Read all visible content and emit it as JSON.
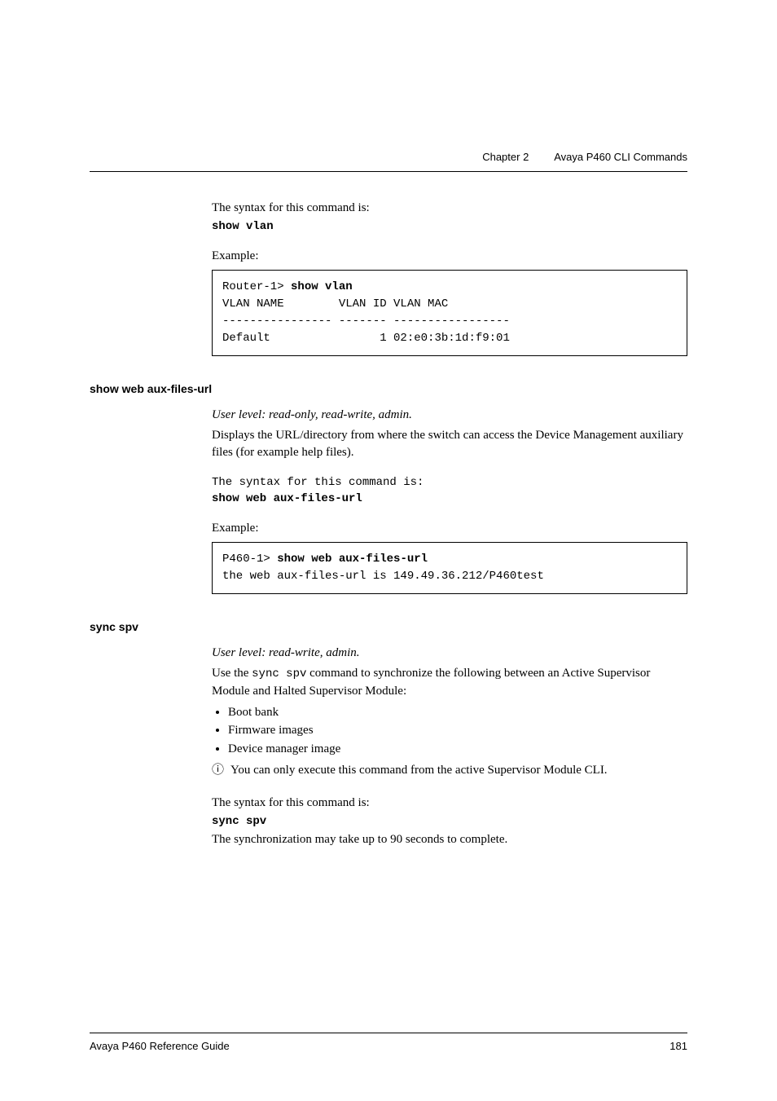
{
  "header": {
    "chapter": "Chapter 2",
    "title": "Avaya P460 CLI Commands"
  },
  "intro": {
    "syntax_label": "The syntax for this command is:",
    "syntax_cmd": "show vlan",
    "example_label": "Example:"
  },
  "example1": {
    "prompt": "Router-1> ",
    "cmd": "show vlan",
    "line2": "VLAN NAME        VLAN ID VLAN MAC",
    "line3": "---------------- ------- -----------------",
    "line4": "Default                1 02:e0:3b:1d:f9:01"
  },
  "section2": {
    "heading": "show web aux-files-url",
    "userlevel": "User level: read-only, read-write, admin.",
    "desc1": "Displays the URL/directory from where the switch can access the Device Management auxiliary files (for example help files).",
    "syntax_label": "The syntax for this command is:",
    "syntax_cmd": "show web aux-files-url",
    "example_label": "Example:"
  },
  "example2": {
    "prompt": "P460-1> ",
    "cmd": "show web aux-files-url",
    "line2": "the web aux-files-url is 149.49.36.212/P460test"
  },
  "section3": {
    "heading": "sync spv",
    "userlevel": "User level: read-write, admin.",
    "desc_pre": "Use the ",
    "desc_cmd": "sync spv",
    "desc_post": " command to synchronize the following between an Active Supervisor Module and Halted Supervisor Module:",
    "bullets": [
      "Boot bank",
      "Firmware images",
      "Device manager image"
    ],
    "info_note": "You can only execute this command from the active Supervisor Module CLI.",
    "syntax_label": "The syntax for this command is:",
    "syntax_cmd": "sync spv",
    "note": "The synchronization may take up to 90 seconds to complete."
  },
  "footer": {
    "doc": "Avaya P460 Reference Guide",
    "page": "181"
  }
}
